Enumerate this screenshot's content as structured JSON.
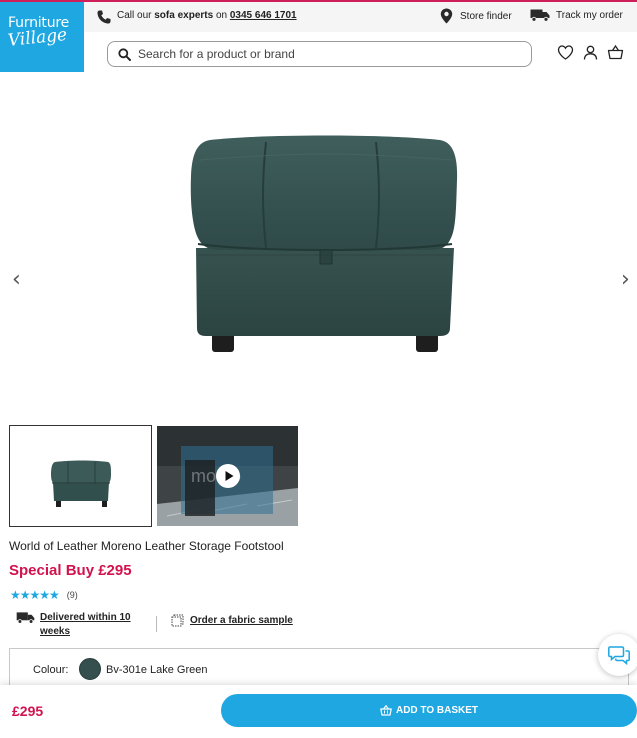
{
  "brand": {
    "logo_line1": "Furniture",
    "logo_line2": "Village",
    "accent": "#1ea7e1",
    "price_color": "#d3124d"
  },
  "helpbar": {
    "call_prefix": "Call our ",
    "call_strong": "sofa experts",
    "call_mid": " on ",
    "phone_number": "0345 646 1701",
    "store_finder": "Store finder",
    "track_order": "Track my order"
  },
  "search": {
    "placeholder": "Search for a product or brand"
  },
  "header_icons": [
    "heart-icon",
    "account-icon",
    "basket-icon"
  ],
  "gallery": {
    "prev": "‹",
    "next": "›",
    "thumbnails": [
      "image",
      "video"
    ],
    "video_overlay_text": "mo  no"
  },
  "product": {
    "title": "World of Leather Moreno Leather Storage Footstool",
    "special_label": "Special Buy ",
    "price": "£295",
    "rating_stars": 5,
    "stars_text": "★★★★★",
    "review_count": "(9)",
    "delivery_text": "Delivered within 10 weeks",
    "fabric_sample_text": "Order a fabric sample",
    "colour_label": "Colour:",
    "colour_value": "Bv-301e Lake Green",
    "colour_hex": "#344f4d"
  },
  "sticky": {
    "price": "£295",
    "add_to_basket": "ADD TO BASKET"
  }
}
